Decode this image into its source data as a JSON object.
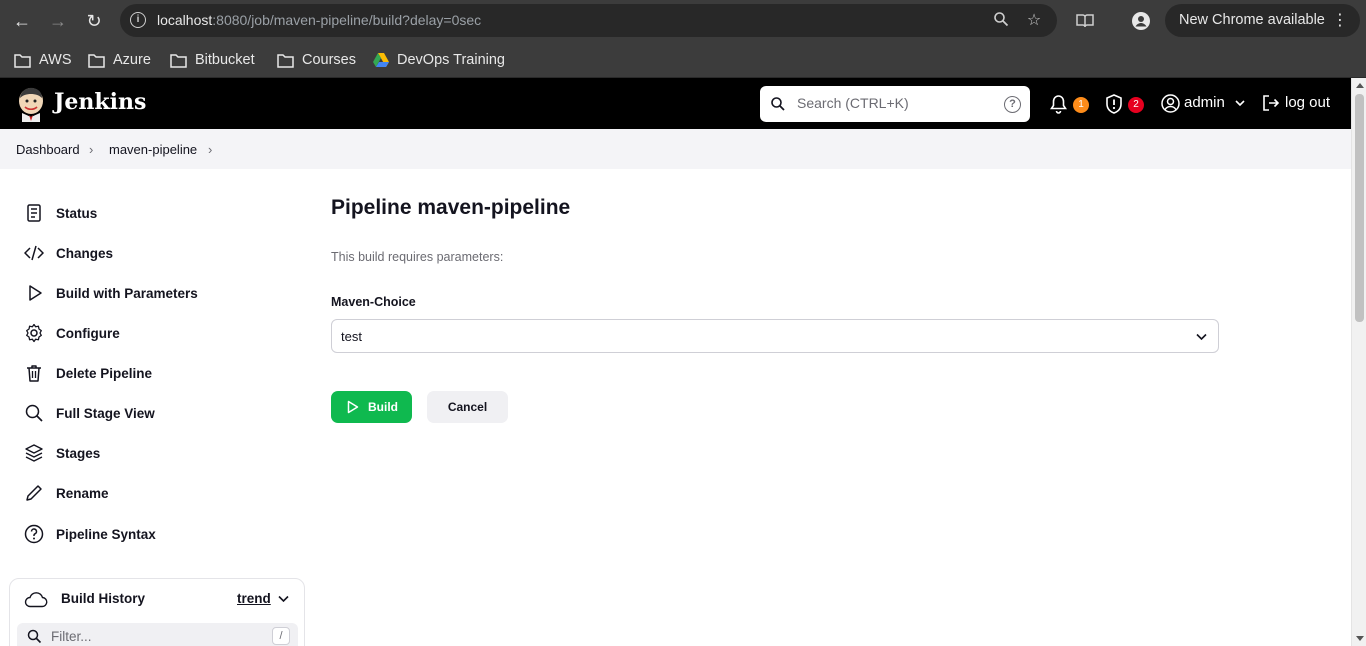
{
  "browser": {
    "url_host": "localhost",
    "url_rest": ":8080/job/maven-pipeline/build?delay=0sec",
    "new_chrome_label": "New Chrome available"
  },
  "bookmarks": [
    {
      "label": "AWS",
      "icon": "folder-icon"
    },
    {
      "label": "Azure",
      "icon": "folder-icon"
    },
    {
      "label": "Bitbucket",
      "icon": "folder-icon"
    },
    {
      "label": "Courses",
      "icon": "folder-icon"
    },
    {
      "label": "DevOps Training",
      "icon": "google-drive-icon"
    }
  ],
  "header": {
    "app_title": "Jenkins",
    "search_placeholder": "Search (CTRL+K)",
    "notifications_count": "1",
    "security_count": "2",
    "user": "admin",
    "logout_label": "log out",
    "badge_colors": {
      "notifications": "#fe8c1a",
      "security": "#e6001f"
    }
  },
  "breadcrumb": [
    "Dashboard",
    "maven-pipeline"
  ],
  "sidebar": {
    "items": [
      {
        "label": "Status",
        "icon": "status-icon"
      },
      {
        "label": "Changes",
        "icon": "code-icon"
      },
      {
        "label": "Build with Parameters",
        "icon": "play-icon"
      },
      {
        "label": "Configure",
        "icon": "gear-icon"
      },
      {
        "label": "Delete Pipeline",
        "icon": "trash-icon"
      },
      {
        "label": "Full Stage View",
        "icon": "search-icon"
      },
      {
        "label": "Stages",
        "icon": "layers-icon"
      },
      {
        "label": "Rename",
        "icon": "pencil-icon"
      },
      {
        "label": "Pipeline Syntax",
        "icon": "help-circle-icon"
      }
    ],
    "build_history": {
      "title": "Build History",
      "trend_label": "trend",
      "filter_placeholder": "Filter...",
      "filter_shortcut": "/"
    }
  },
  "main": {
    "title": "Pipeline maven-pipeline",
    "requires_text": "This build requires parameters:",
    "parameter": {
      "label": "Maven-Choice",
      "selected": "test"
    },
    "build_label": "Build",
    "cancel_label": "Cancel",
    "accent_color": "#0fb94f"
  }
}
